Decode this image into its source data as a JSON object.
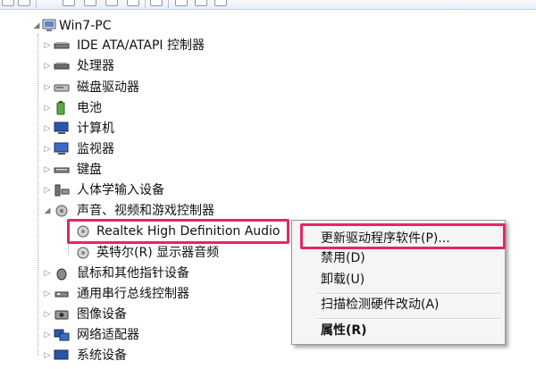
{
  "tree": {
    "root": "Win7-PC",
    "items": [
      {
        "label": "IDE ATA/ATAPI 控制器",
        "icon": "ide-controller-icon"
      },
      {
        "label": "处理器",
        "icon": "processor-icon"
      },
      {
        "label": "磁盘驱动器",
        "icon": "disk-drive-icon"
      },
      {
        "label": "电池",
        "icon": "battery-icon"
      },
      {
        "label": "计算机",
        "icon": "computer-icon"
      },
      {
        "label": "监视器",
        "icon": "monitor-icon"
      },
      {
        "label": "键盘",
        "icon": "keyboard-icon"
      },
      {
        "label": "人体学输入设备",
        "icon": "hid-icon"
      },
      {
        "label": "声音、视频和游戏控制器",
        "icon": "audio-icon"
      },
      {
        "label": "Realtek High Definition Audio",
        "icon": "speaker-icon"
      },
      {
        "label": "英特尔(R) 显示器音频",
        "icon": "speaker-icon"
      },
      {
        "label": "鼠标和其他指针设备",
        "icon": "mouse-icon"
      },
      {
        "label": "通用串行总线控制器",
        "icon": "usb-icon"
      },
      {
        "label": "图像设备",
        "icon": "camera-icon"
      },
      {
        "label": "网络适配器",
        "icon": "network-icon"
      },
      {
        "label": "系统设备",
        "icon": "system-icon"
      }
    ]
  },
  "context_menu": {
    "update_driver": "更新驱动程序软件(P)...",
    "disable": "禁用(D)",
    "uninstall": "卸载(U)",
    "scan": "扫描检测硬件改动(A)",
    "properties": "属性(R)"
  },
  "colors": {
    "highlight_border": "#e3285f",
    "menu_bg": "#f5f5f5"
  }
}
